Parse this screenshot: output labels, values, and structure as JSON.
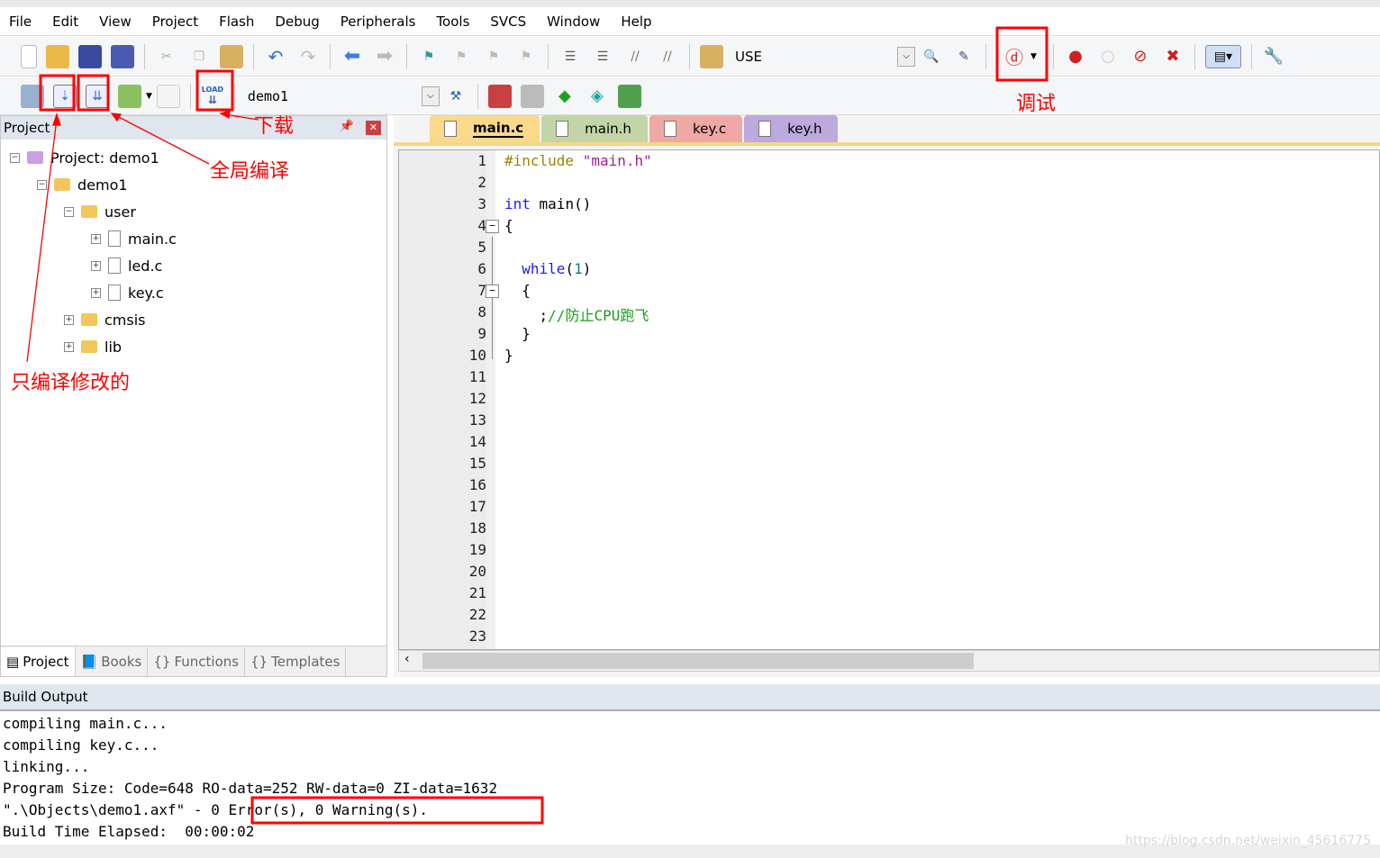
{
  "menu": [
    "File",
    "Edit",
    "View",
    "Project",
    "Flash",
    "Debug",
    "Peripherals",
    "Tools",
    "SVCS",
    "Window",
    "Help"
  ],
  "toolbar1": {
    "search_text": "USE"
  },
  "toolbar2": {
    "target": "demo1"
  },
  "project_panel": {
    "title": "Project",
    "tree": [
      {
        "label": "Project: demo1",
        "level": 0,
        "type": "project",
        "toggle": "−"
      },
      {
        "label": "demo1",
        "level": 1,
        "type": "target",
        "toggle": "−"
      },
      {
        "label": "user",
        "level": 2,
        "type": "folder",
        "toggle": "−"
      },
      {
        "label": "main.c",
        "level": 3,
        "type": "file",
        "toggle": "+"
      },
      {
        "label": "led.c",
        "level": 3,
        "type": "file",
        "toggle": "+"
      },
      {
        "label": "key.c",
        "level": 3,
        "type": "file",
        "toggle": "+"
      },
      {
        "label": "cmsis",
        "level": 2,
        "type": "folder",
        "toggle": "+"
      },
      {
        "label": "lib",
        "level": 2,
        "type": "folder",
        "toggle": "+"
      }
    ],
    "tabs": [
      "Project",
      "Books",
      "Functions",
      "Templates"
    ]
  },
  "editor": {
    "tabs": [
      {
        "label": "main.c",
        "color": "#fbd98a",
        "active": true
      },
      {
        "label": "main.h",
        "color": "#c3d5a6"
      },
      {
        "label": "key.c",
        "color": "#f0a8a4"
      },
      {
        "label": "key.h",
        "color": "#bca9dd"
      }
    ],
    "line_count": 23,
    "code": [
      {
        "line": 1,
        "parts": [
          {
            "t": "#include ",
            "c": "#a08000"
          },
          {
            "t": "\"main.h\"",
            "c": "#a0208c"
          }
        ]
      },
      {
        "line": 3,
        "parts": [
          {
            "t": "int",
            "c": "#1a1aff"
          },
          {
            "t": " main()",
            "c": "#000"
          }
        ]
      },
      {
        "line": 4,
        "parts": [
          {
            "t": "{",
            "c": "#000"
          }
        ]
      },
      {
        "line": 6,
        "parts": [
          {
            "t": "  while",
            "c": "#1a1aff"
          },
          {
            "t": "(",
            "c": "#000"
          },
          {
            "t": "1",
            "c": "#008080"
          },
          {
            "t": ")",
            "c": "#000"
          }
        ]
      },
      {
        "line": 7,
        "parts": [
          {
            "t": "  {",
            "c": "#000"
          }
        ]
      },
      {
        "line": 8,
        "parts": [
          {
            "t": "    ;",
            "c": "#000"
          },
          {
            "t": "//防止CPU跑飞",
            "c": "#1c9c1c"
          }
        ]
      },
      {
        "line": 9,
        "parts": [
          {
            "t": "  }",
            "c": "#000"
          }
        ]
      },
      {
        "line": 10,
        "parts": [
          {
            "t": "}",
            "c": "#000"
          }
        ]
      }
    ]
  },
  "build_output": {
    "title": "Build Output",
    "lines": [
      "compiling main.c...",
      "compiling key.c...",
      "linking...",
      "Program Size: Code=648 RO-data=252 RW-data=0 ZI-data=1632",
      "\".\\Objects\\demo1.axf\" - 0 Error(s), 0 Warning(s).",
      "Build Time Elapsed:  00:00:02"
    ]
  },
  "annotations": {
    "download": "下载",
    "rebuild": "全局编译",
    "build_changed": "只编译修改的",
    "debug": "调试",
    "highlight_color": "#ff0000"
  },
  "watermark": "https://blog.csdn.net/weixin_45616775"
}
